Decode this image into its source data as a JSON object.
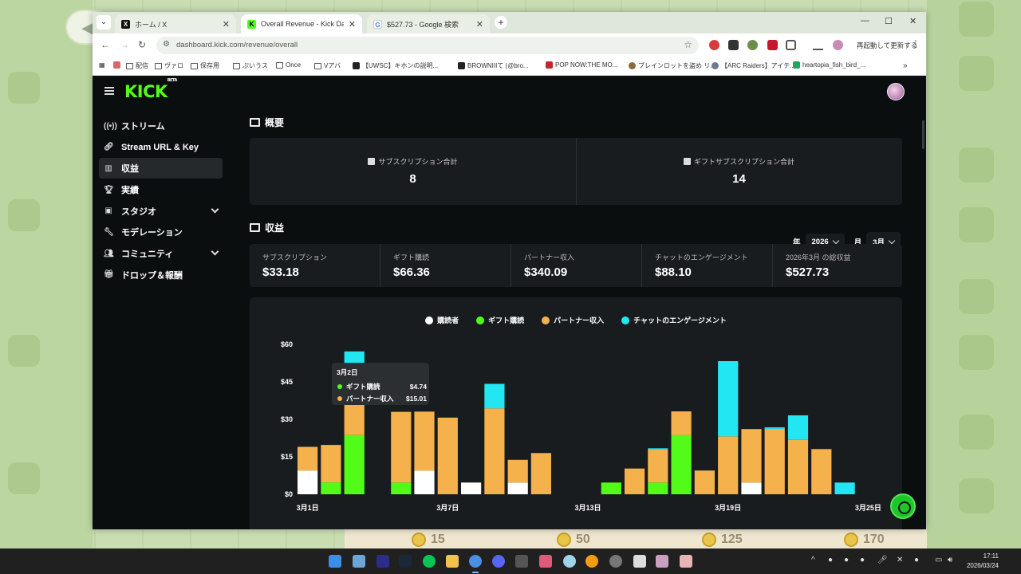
{
  "browser": {
    "tabs": [
      {
        "title": "ホーム / X",
        "favicon": "x-icon",
        "active": false
      },
      {
        "title": "Overall Revenue - Kick Dashboard",
        "favicon": "kick-icon",
        "active": true
      },
      {
        "title": "$527.73 - Google 検索",
        "favicon": "google-icon",
        "active": false
      }
    ],
    "new_tab_label": "+",
    "url": "dashboard.kick.com/revenue/overall",
    "restart_label": "再起動して更新する",
    "bookmarks": [
      "配信",
      "ヴァロ",
      "保存用",
      "ぷいうス",
      "Once",
      "Vアバ",
      "【UWSC】キホンの説明...",
      "BROWNIIIて (@bro...",
      "POP NOW:THE MO...",
      "ブレインロットを盗め リ...",
      "【ARC Raiders】アイテ...",
      "heartopia_fish_bird_..."
    ]
  },
  "sidebar": {
    "items": [
      {
        "label": "ストリーム",
        "icon": "broadcast-icon",
        "active": false,
        "expand": false
      },
      {
        "label": "Stream URL & Key",
        "icon": "link-icon",
        "active": false,
        "expand": false
      },
      {
        "label": "収益",
        "icon": "chart-icon",
        "active": true,
        "expand": false
      },
      {
        "label": "実績",
        "icon": "trophy-icon",
        "active": false,
        "expand": false
      },
      {
        "label": "スタジオ",
        "icon": "studio-icon",
        "active": false,
        "expand": true
      },
      {
        "label": "モデレーション",
        "icon": "wrench-icon",
        "active": false,
        "expand": false
      },
      {
        "label": "コミュニティ",
        "icon": "users-icon",
        "active": false,
        "expand": true
      },
      {
        "label": "ドロップ＆報酬",
        "icon": "gift-icon",
        "active": false,
        "expand": false
      }
    ]
  },
  "overview": {
    "title": "概要",
    "cards": [
      {
        "label": "サブスクリプション合計",
        "value": "8"
      },
      {
        "label": "ギフトサブスクリプション合計",
        "value": "14"
      }
    ]
  },
  "revenue": {
    "title": "収益",
    "year_label": "年",
    "year_value": "2026",
    "month_label": "月",
    "month_value": "3月",
    "kpis": [
      {
        "label": "サブスクリプション",
        "value": "$33.18"
      },
      {
        "label": "ギフト購読",
        "value": "$66.36"
      },
      {
        "label": "パートナー収入",
        "value": "$340.09"
      },
      {
        "label": "チャットのエンゲージメント",
        "value": "$88.10"
      },
      {
        "label": "2026年3月 の総収益",
        "value": "$527.73"
      }
    ]
  },
  "tooltip": {
    "title": "3月2日",
    "rows": [
      {
        "label": "ギフト購読",
        "value": "$4.74",
        "color": "#53fc18"
      },
      {
        "label": "パートナー収入",
        "value": "$15.01",
        "color": "#f5b14c"
      }
    ]
  },
  "colors": {
    "accent": "#53fc18",
    "subscriber": "#ffffff",
    "gift": "#53fc18",
    "partner": "#f5b14c",
    "chat": "#22e6f2"
  },
  "chart_data": {
    "type": "bar",
    "stacked": true,
    "categories": [
      "3月1日",
      "3月2日",
      "3月3日",
      "3月4日",
      "3月5日",
      "3月6日",
      "3月7日",
      "3月8日",
      "3月9日",
      "3月10日",
      "3月11日",
      "3月12日",
      "3月13日",
      "3月14日",
      "3月15日",
      "3月16日",
      "3月17日",
      "3月18日",
      "3月19日",
      "3月20日",
      "3月21日",
      "3月22日",
      "3月23日",
      "3月24日",
      "3月25日"
    ],
    "x_tick_labels": [
      "3月1日",
      "3月7日",
      "3月13日",
      "3月19日",
      "3月25日"
    ],
    "y_tick_labels": [
      "$0",
      "$15",
      "$30",
      "$45",
      "$60"
    ],
    "ylim": [
      0,
      60
    ],
    "series": [
      {
        "name": "購読者",
        "color": "#ffffff",
        "values": [
          9.5,
          0,
          0,
          0,
          0,
          9.5,
          0,
          4.7,
          0,
          4.7,
          0,
          0,
          0,
          0,
          0,
          0,
          0,
          0,
          0,
          4.7,
          0,
          0,
          0,
          0,
          0
        ]
      },
      {
        "name": "ギフト購読",
        "color": "#53fc18",
        "values": [
          0,
          4.74,
          23.7,
          0,
          4.7,
          0,
          0,
          0,
          0,
          0,
          0,
          0,
          0,
          4.7,
          0,
          4.7,
          23.7,
          0,
          0,
          0,
          0,
          0,
          0,
          0,
          0
        ]
      },
      {
        "name": "パートナー収入",
        "color": "#f5b14c",
        "values": [
          9.5,
          15.01,
          14.2,
          0,
          28.3,
          23.6,
          30.7,
          0,
          34.4,
          9.1,
          16.5,
          0,
          0,
          0,
          10.3,
          13.2,
          9.5,
          9.5,
          23.2,
          21.4,
          26.2,
          21.8,
          18.1,
          0,
          0
        ]
      },
      {
        "name": "チャットのエンゲージメント",
        "color": "#22e6f2",
        "values": [
          0,
          0,
          19.3,
          0,
          0,
          0,
          0,
          0,
          9.8,
          0,
          0,
          0,
          0,
          0,
          0,
          0.5,
          0,
          0,
          30.1,
          0,
          0.6,
          9.8,
          0,
          4.7,
          0
        ]
      }
    ],
    "grid": false,
    "legend_position": "top-center"
  },
  "taskbar": {
    "time": "17:11",
    "date": "2026/03/24"
  },
  "desktop": {
    "coins": [
      "15",
      "50",
      "125",
      "170"
    ]
  }
}
